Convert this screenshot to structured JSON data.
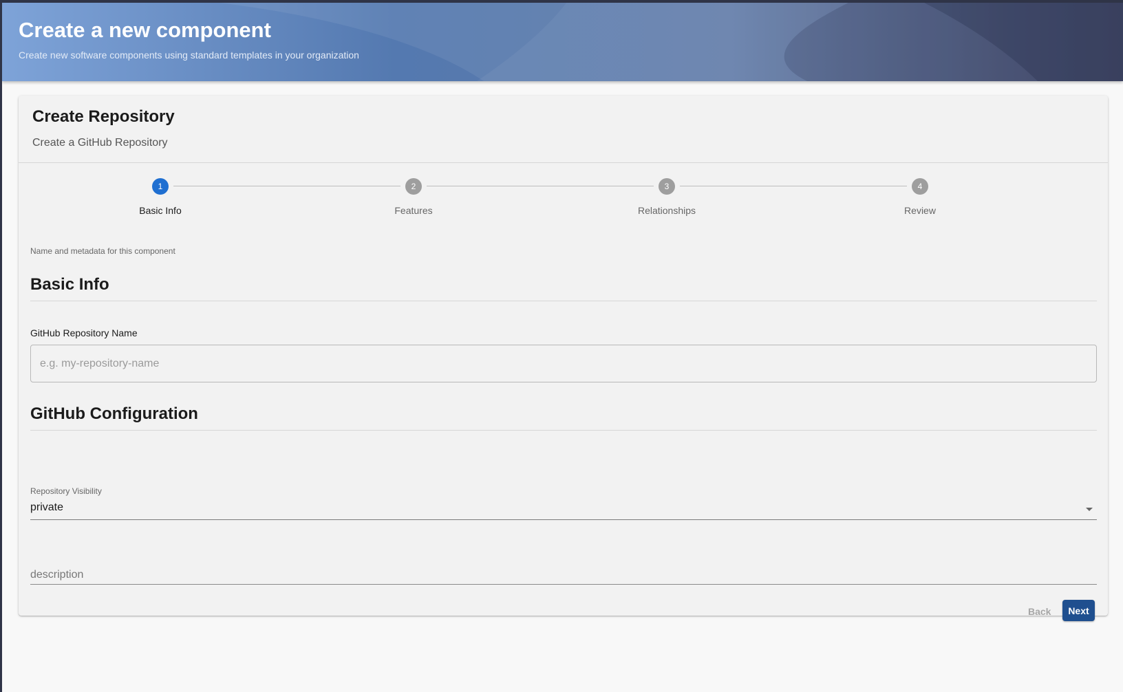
{
  "header": {
    "title": "Create a new component",
    "subtitle": "Create new software components using standard templates in your organization"
  },
  "card": {
    "title": "Create Repository",
    "subtitle": "Create a GitHub Repository"
  },
  "stepper": {
    "active_step": 1,
    "steps": [
      {
        "number": "1",
        "label": "Basic Info"
      },
      {
        "number": "2",
        "label": "Features"
      },
      {
        "number": "3",
        "label": "Relationships"
      },
      {
        "number": "4",
        "label": "Review"
      }
    ]
  },
  "form": {
    "step_description": "Name and metadata for this component",
    "section_basic": "Basic Info",
    "repo_name_label": "GitHub Repository Name",
    "repo_name_value": "",
    "repo_name_placeholder": "e.g. my-repository-name",
    "section_config": "GitHub Configuration",
    "visibility_label": "Repository Visibility",
    "visibility_value": "private",
    "description_placeholder": "description"
  },
  "actions": {
    "back_label": "Back",
    "next_label": "Next"
  },
  "colors": {
    "accent": "#1f6fd1",
    "next_button": "#1f4f8f",
    "inactive_step": "#9e9e9e"
  }
}
